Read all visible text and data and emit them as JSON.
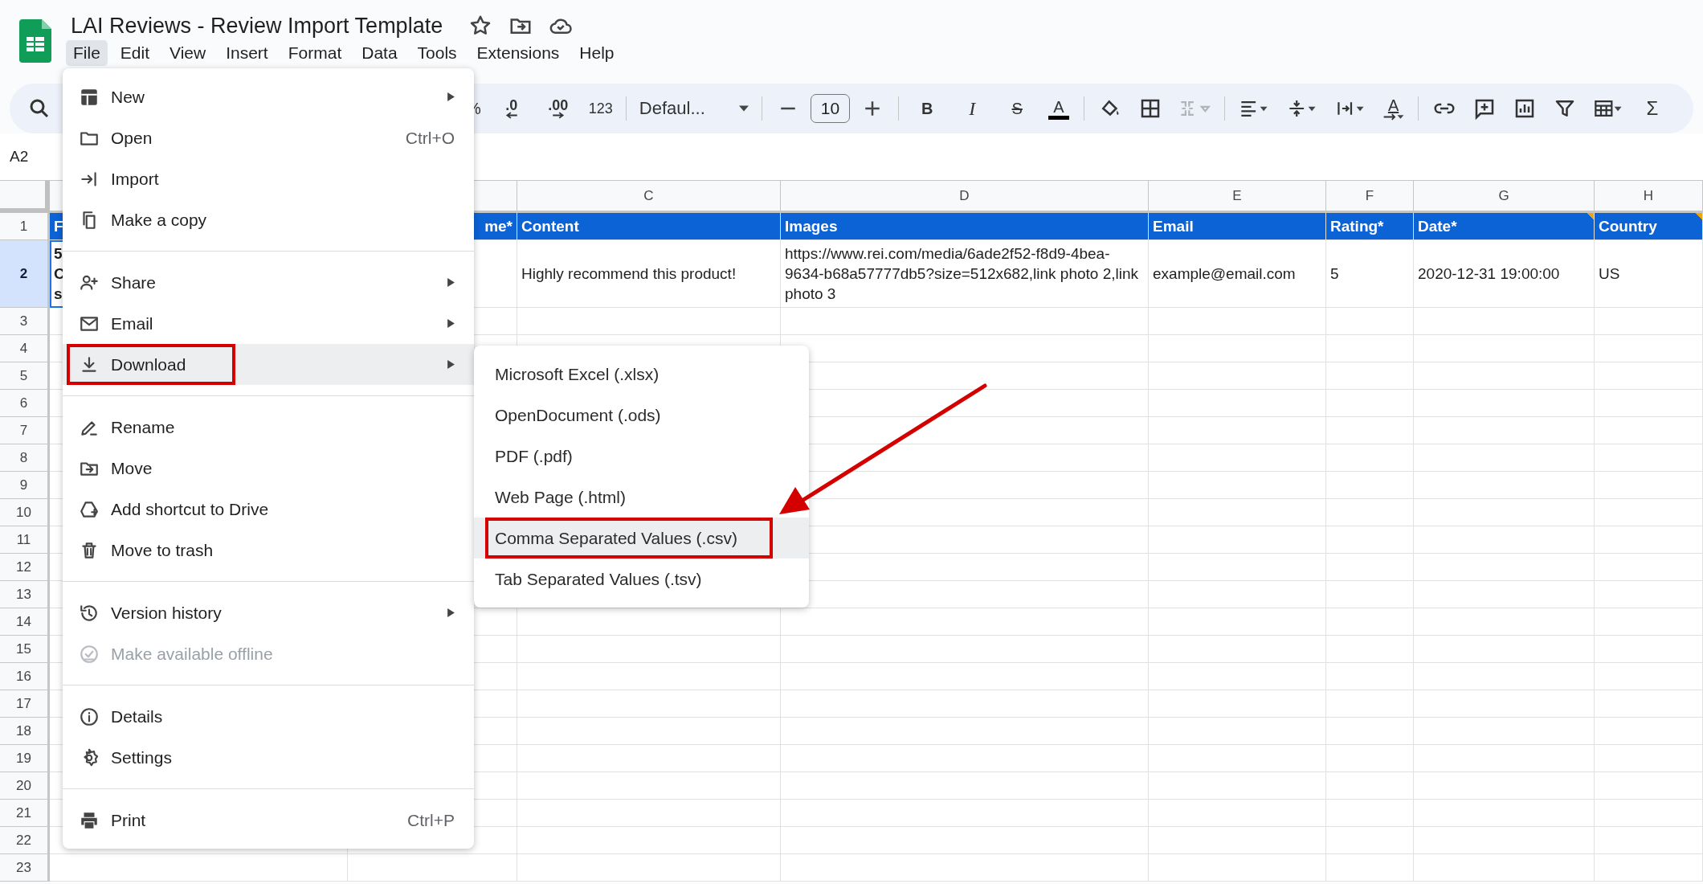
{
  "doc": {
    "title": "LAI Reviews - Review Import Template"
  },
  "menubar": [
    {
      "label": "File",
      "selected": true
    },
    {
      "label": "Edit",
      "selected": false
    },
    {
      "label": "View",
      "selected": false
    },
    {
      "label": "Insert",
      "selected": false
    },
    {
      "label": "Format",
      "selected": false
    },
    {
      "label": "Data",
      "selected": false
    },
    {
      "label": "Tools",
      "selected": false
    },
    {
      "label": "Extensions",
      "selected": false
    },
    {
      "label": "Help",
      "selected": false
    }
  ],
  "toolbar": {
    "percent": "%",
    "decrease_decimals": ".0",
    "increase_decimals": ".00",
    "number_format": "123",
    "font": "Defaul...",
    "font_size": "10",
    "bold": "B",
    "italic": "I",
    "strikethrough": "S",
    "text_color": "A",
    "text_rotation": "A",
    "functions": "Σ",
    "merge_disabled": true
  },
  "name_box": "A2",
  "sheet": {
    "column_letters": [
      "C",
      "D",
      "E",
      "F",
      "G",
      "H"
    ],
    "header_row": [
      {
        "text": "F"
      },
      {
        "text": "me*",
        "note": false
      },
      {
        "text": "Content",
        "note": false
      },
      {
        "text": "Images",
        "note": false
      },
      {
        "text": "Email",
        "note": false
      },
      {
        "text": "Rating*",
        "note": false
      },
      {
        "text": "Date*",
        "note": true
      },
      {
        "text": "Country",
        "note": true
      }
    ],
    "data_row": [
      {
        "text": "5\nC\ns"
      },
      {
        "text": "Highly recommend this product!"
      },
      {
        "text": "https://www.rei.com/media/6ade2f52-f8d9-4bea-9634-b68a57777db5?size=512x682,link photo 2,link photo 3"
      },
      {
        "text": "example@email.com"
      },
      {
        "text": "5"
      },
      {
        "text": "2020-12-31 19:00:00"
      },
      {
        "text": "US"
      }
    ],
    "rows": [
      {
        "label": "1",
        "selected": false
      },
      {
        "label": "2",
        "selected": true
      },
      {
        "label": "3",
        "selected": false
      },
      {
        "label": "4",
        "selected": false
      },
      {
        "label": "5",
        "selected": false
      },
      {
        "label": "6",
        "selected": false
      },
      {
        "label": "7",
        "selected": false
      },
      {
        "label": "8",
        "selected": false
      },
      {
        "label": "9",
        "selected": false
      },
      {
        "label": "10",
        "selected": false
      },
      {
        "label": "11",
        "selected": false
      },
      {
        "label": "12",
        "selected": false
      },
      {
        "label": "13",
        "selected": false
      },
      {
        "label": "14",
        "selected": false
      },
      {
        "label": "15",
        "selected": false
      },
      {
        "label": "16",
        "selected": false
      },
      {
        "label": "17",
        "selected": false
      },
      {
        "label": "18",
        "selected": false
      },
      {
        "label": "19",
        "selected": false
      },
      {
        "label": "20",
        "selected": false
      },
      {
        "label": "21",
        "selected": false
      },
      {
        "label": "22",
        "selected": false
      },
      {
        "label": "23",
        "selected": false
      }
    ]
  },
  "file_menu": {
    "groups": [
      [
        {
          "label": "New",
          "submenu": true,
          "disabled": false,
          "selected": false,
          "highlighted": false
        },
        {
          "label": "Open",
          "shortcut": "Ctrl+O",
          "submenu": false,
          "disabled": false,
          "selected": false,
          "highlighted": false
        },
        {
          "label": "Import",
          "submenu": false,
          "disabled": false,
          "selected": false,
          "highlighted": false
        },
        {
          "label": "Make a copy",
          "submenu": false,
          "disabled": false,
          "selected": false,
          "highlighted": false
        }
      ],
      [
        {
          "label": "Share",
          "submenu": true,
          "disabled": false,
          "selected": false,
          "highlighted": false
        },
        {
          "label": "Email",
          "submenu": true,
          "disabled": false,
          "selected": false,
          "highlighted": false
        },
        {
          "label": "Download",
          "submenu": true,
          "disabled": false,
          "selected": true,
          "highlighted": true
        }
      ],
      [
        {
          "label": "Rename",
          "submenu": false,
          "disabled": false,
          "selected": false,
          "highlighted": false
        },
        {
          "label": "Move",
          "submenu": false,
          "disabled": false,
          "selected": false,
          "highlighted": false
        },
        {
          "label": "Add shortcut to Drive",
          "submenu": false,
          "disabled": false,
          "selected": false,
          "highlighted": false
        },
        {
          "label": "Move to trash",
          "submenu": false,
          "disabled": false,
          "selected": false,
          "highlighted": false
        }
      ],
      [
        {
          "label": "Version history",
          "submenu": true,
          "disabled": false,
          "selected": false,
          "highlighted": false
        },
        {
          "label": "Make available offline",
          "submenu": false,
          "disabled": true,
          "selected": false,
          "highlighted": false
        }
      ],
      [
        {
          "label": "Details",
          "submenu": false,
          "disabled": false,
          "selected": false,
          "highlighted": false
        },
        {
          "label": "Settings",
          "submenu": false,
          "disabled": false,
          "selected": false,
          "highlighted": false
        }
      ],
      [
        {
          "label": "Print",
          "shortcut": "Ctrl+P",
          "submenu": false,
          "disabled": false,
          "selected": false,
          "highlighted": false
        }
      ]
    ]
  },
  "download_menu": [
    {
      "label": "Microsoft Excel (.xlsx)",
      "selected": false,
      "highlighted": false
    },
    {
      "label": "OpenDocument (.ods)",
      "selected": false,
      "highlighted": false
    },
    {
      "label": "PDF (.pdf)",
      "selected": false,
      "highlighted": false
    },
    {
      "label": "Web Page (.html)",
      "selected": false,
      "highlighted": false
    },
    {
      "label": "Comma Separated Values (.csv)",
      "selected": true,
      "highlighted": true
    },
    {
      "label": "Tab Separated Values (.tsv)",
      "selected": false,
      "highlighted": false
    }
  ]
}
